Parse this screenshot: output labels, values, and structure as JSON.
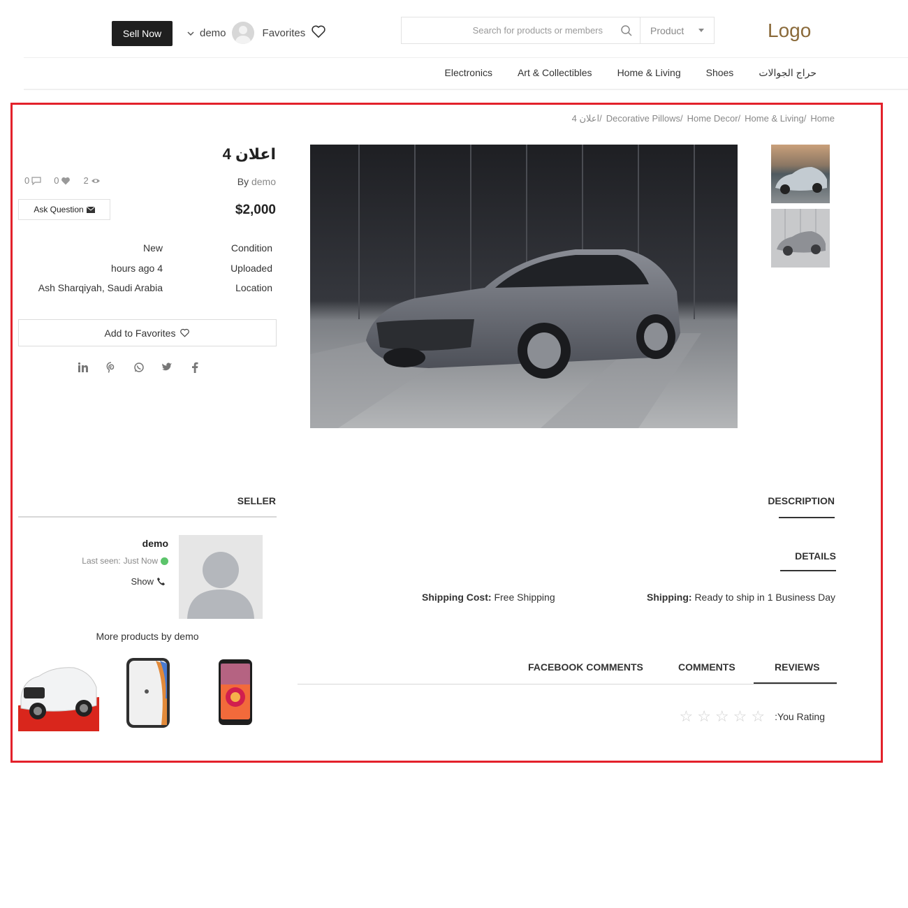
{
  "header": {
    "sell_label": "Sell Now",
    "username": "demo",
    "favorites_label": "Favorites",
    "search_placeholder": "Search for products or members",
    "search_category": "Product",
    "logo_text": "Logo"
  },
  "nav": {
    "items": [
      "Electronics",
      "Art & Collectibles",
      "Home & Living",
      "Shoes",
      "حراج الجوالات"
    ]
  },
  "breadcrumb": [
    "4 اعلان/",
    "Decorative Pillows/",
    "Home Decor/",
    "Home & Living/",
    "Home"
  ],
  "listing": {
    "title": "اعلان 4",
    "by_label": "By",
    "seller": "demo",
    "price": "$2,000",
    "comments_count": "0",
    "likes_count": "0",
    "views_count": "2",
    "ask_question_label": "Ask Question",
    "condition_label": "Condition",
    "condition_value": "New",
    "uploaded_label": "Uploaded",
    "uploaded_value": "hours ago 4",
    "location_label": "Location",
    "location_value": "Ash Sharqiyah, Saudi Arabia",
    "add_favorites_label": "Add to Favorites",
    "social_icons": [
      "linkedin-icon",
      "pinterest-icon",
      "whatsapp-icon",
      "twitter-icon",
      "facebook-icon"
    ]
  },
  "seller": {
    "section_title": "SELLER",
    "name": "demo",
    "last_seen_label": "Last seen:",
    "last_seen_value": "Just Now",
    "show_phone_label": "Show",
    "more_products_label": "More products by demo"
  },
  "details": {
    "description_tab": "DESCRIPTION",
    "details_tab": "DETAILS",
    "shipping_cost_label": "Shipping Cost:",
    "shipping_cost_value": "Free Shipping",
    "shipping_label": "Shipping:",
    "shipping_value": "Ready to ship in 1 Business Day"
  },
  "tabs": {
    "facebook_comments": "FACEBOOK COMMENTS",
    "comments": "COMMENTS",
    "reviews": "REVIEWS"
  },
  "rating": {
    "label": ":You Rating",
    "stars": 0,
    "max_stars": 5
  },
  "colors": {
    "frame": "#e3212b",
    "logo": "#8a6a3a",
    "online": "#5cc46b"
  }
}
